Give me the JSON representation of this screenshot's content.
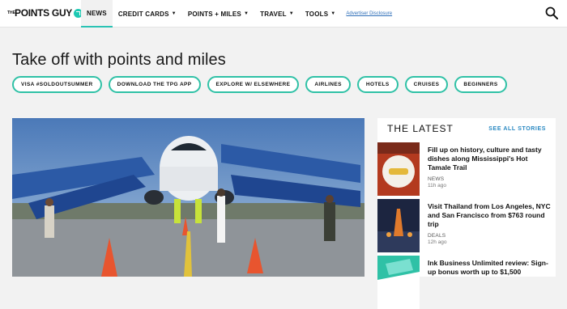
{
  "header": {
    "logo_prefix": "THE",
    "logo_text": "POINTS GUY",
    "nav": [
      {
        "label": "NEWS",
        "caret": ""
      },
      {
        "label": "CREDIT CARDS",
        "caret": "▼"
      },
      {
        "label": "POINTS + MILES",
        "caret": "▼"
      },
      {
        "label": "TRAVEL",
        "caret": "▼"
      },
      {
        "label": "TOOLS",
        "caret": "▼"
      }
    ],
    "disclosure": "Advertiser Disclosure"
  },
  "main": {
    "title": "Take off with points and miles",
    "pills": [
      "VISA #SOLDOUTSUMMER",
      "DOWNLOAD THE TPG APP",
      "EXPLORE W/ ELSEWHERE",
      "AIRLINES",
      "HOTELS",
      "CRUISES",
      "BEGINNERS"
    ]
  },
  "latest": {
    "title": "THE LATEST",
    "see_all": "SEE ALL STORIES",
    "stories": [
      {
        "title": "Fill up on history, culture and tasty dishes along Mississippi's Hot Tamale Trail",
        "category": "NEWS",
        "time": "11h ago"
      },
      {
        "title": "Visit Thailand from Los Angeles, NYC and San Francisco from $763 round trip",
        "category": "DEALS",
        "time": "12h ago"
      },
      {
        "title": "Ink Business Unlimited review: Sign-up bonus worth up to $1,500",
        "category": "",
        "time": ""
      }
    ]
  },
  "colors": {
    "accent": "#2fc1a6",
    "link": "#2a89c2",
    "background": "#f2f2f2"
  }
}
